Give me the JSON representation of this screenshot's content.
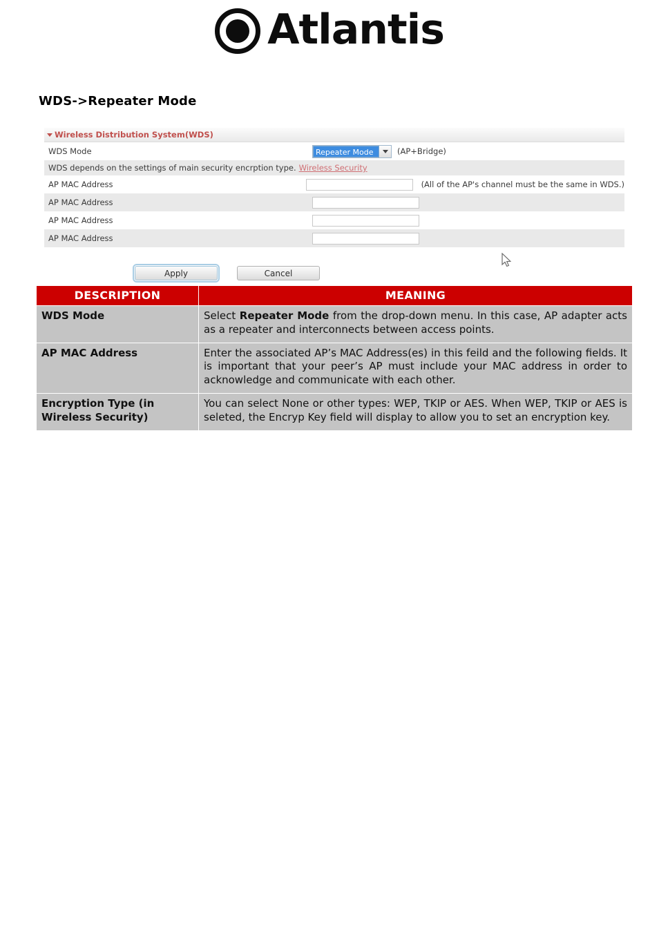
{
  "brand": {
    "name": "Atlantis",
    "logo_icon": "circle-dot-icon"
  },
  "page": {
    "heading": "WDS->Repeater Mode"
  },
  "router_panel": {
    "section_title": "Wireless Distribution System(WDS)",
    "caret_icon": "triangle-down-icon",
    "wds_mode": {
      "label": "WDS Mode",
      "selected_value": "Repeater Mode",
      "dropdown_arrow_icon": "chevron-down-icon",
      "suffix": "(AP+Bridge)"
    },
    "depends_note": {
      "text": "WDS depends on the settings of main security encrption type.",
      "link_text": "Wireless Security"
    },
    "mac_rows": [
      {
        "label": "AP MAC Address",
        "value": "",
        "hint": "(All of the AP's channel must be the same in WDS.)"
      },
      {
        "label": "AP MAC Address",
        "value": "",
        "hint": ""
      },
      {
        "label": "AP MAC Address",
        "value": "",
        "hint": ""
      },
      {
        "label": "AP MAC Address",
        "value": "",
        "hint": ""
      }
    ],
    "buttons": {
      "apply": "Apply",
      "cancel": "Cancel"
    },
    "cursor_icon": "mouse-pointer-icon"
  },
  "desc_table": {
    "headers": {
      "description": "DESCRIPTION",
      "meaning": "MEANING"
    },
    "rows": [
      {
        "description": "WDS Mode",
        "meaning_pre": "Select ",
        "meaning_kw": "Repeater Mode",
        "meaning_post": " from the drop-down menu. In this case, AP adapter acts as a repeater and interconnects between access points."
      },
      {
        "description": "AP MAC Address",
        "meaning_pre": "Enter the associated AP’s MAC Address(es) in this feild and the following fields. It is important that your peer’s AP must include your MAC address in order to acknowledge and communicate with each other.",
        "meaning_kw": "",
        "meaning_post": ""
      },
      {
        "description": "Encryption Type (in Wireless Security)",
        "meaning_pre": "You can select None or other types: WEP, TKIP or AES. When WEP, TKIP or AES is seleted, the Encryp Key field will display to allow you to set an encryption key.",
        "meaning_kw": "",
        "meaning_post": ""
      }
    ]
  },
  "colors": {
    "brand_red": "#cc0000",
    "section_title_red": "#c0504d",
    "link_red": "#d06f74",
    "select_highlight": "#3d8ce0",
    "table_body_gray": "#c4c4c4"
  }
}
